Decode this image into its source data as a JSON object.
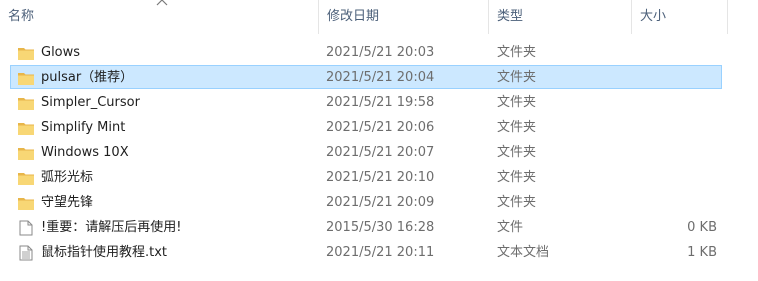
{
  "columns": {
    "name": "名称",
    "date": "修改日期",
    "type": "类型",
    "size": "大小"
  },
  "files": [
    {
      "icon": "folder-icon",
      "name": "Glows",
      "date": "2021/5/21 20:03",
      "type": "文件夹",
      "size": "",
      "selected": false
    },
    {
      "icon": "folder-icon",
      "name": "pulsar（推荐）",
      "date": "2021/5/21 20:04",
      "type": "文件夹",
      "size": "",
      "selected": true
    },
    {
      "icon": "folder-icon",
      "name": "Simpler_Cursor",
      "date": "2021/5/21 19:58",
      "type": "文件夹",
      "size": "",
      "selected": false
    },
    {
      "icon": "folder-icon",
      "name": "Simplify Mint",
      "date": "2021/5/21 20:06",
      "type": "文件夹",
      "size": "",
      "selected": false
    },
    {
      "icon": "folder-icon",
      "name": "Windows 10X",
      "date": "2021/5/21 20:07",
      "type": "文件夹",
      "size": "",
      "selected": false
    },
    {
      "icon": "folder-icon",
      "name": "弧形光标",
      "date": "2021/5/21 20:10",
      "type": "文件夹",
      "size": "",
      "selected": false
    },
    {
      "icon": "folder-icon",
      "name": "守望先锋",
      "date": "2021/5/21 20:09",
      "type": "文件夹",
      "size": "",
      "selected": false
    },
    {
      "icon": "blank-file-icon",
      "name": "!重要：请解压后再使用!",
      "date": "2015/5/30 16:28",
      "type": "文件",
      "size": "0 KB",
      "selected": false
    },
    {
      "icon": "text-file-icon",
      "name": "鼠标指针使用教程.txt",
      "date": "2021/5/21 20:11",
      "type": "文本文档",
      "size": "1 KB",
      "selected": false
    }
  ],
  "colors": {
    "selection_bg": "#cce8ff",
    "selection_border": "#99d1ff",
    "folder": "#f8d775",
    "header_text": "#4c607a"
  }
}
